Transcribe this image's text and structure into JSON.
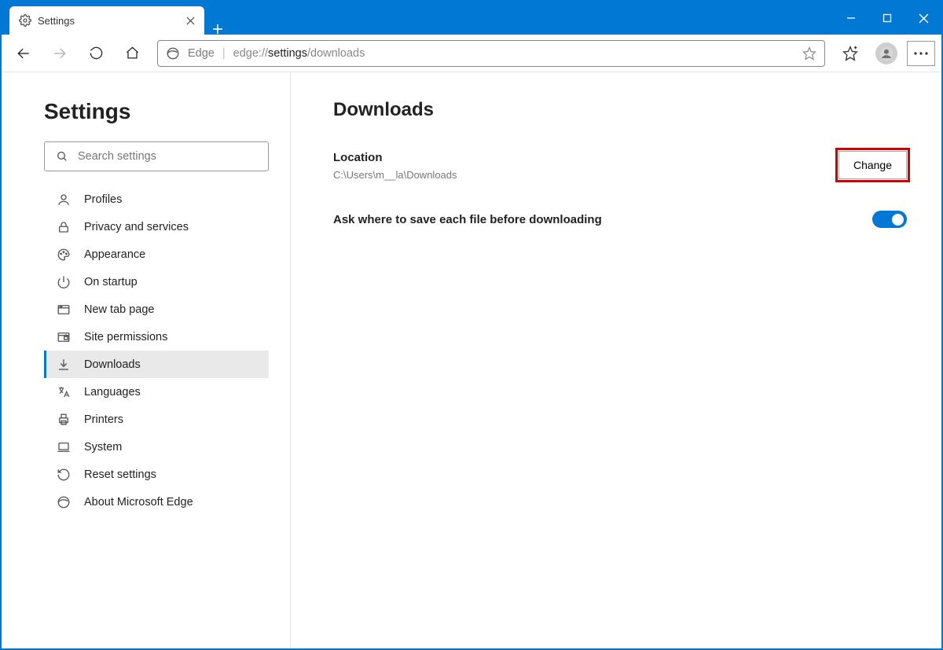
{
  "tab": {
    "title": "Settings"
  },
  "addressbar": {
    "scheme_label": "Edge",
    "url_prefix": "edge://",
    "url_strong": "settings",
    "url_suffix": "/downloads"
  },
  "sidebar": {
    "title": "Settings",
    "search_placeholder": "Search settings",
    "items": [
      {
        "label": "Profiles"
      },
      {
        "label": "Privacy and services"
      },
      {
        "label": "Appearance"
      },
      {
        "label": "On startup"
      },
      {
        "label": "New tab page"
      },
      {
        "label": "Site permissions"
      },
      {
        "label": "Downloads"
      },
      {
        "label": "Languages"
      },
      {
        "label": "Printers"
      },
      {
        "label": "System"
      },
      {
        "label": "Reset settings"
      },
      {
        "label": "About Microsoft Edge"
      }
    ]
  },
  "main": {
    "heading": "Downloads",
    "location_label": "Location",
    "location_path": "C:\\Users\\m__la\\Downloads",
    "change_label": "Change",
    "ask_where_label": "Ask where to save each file before downloading"
  }
}
